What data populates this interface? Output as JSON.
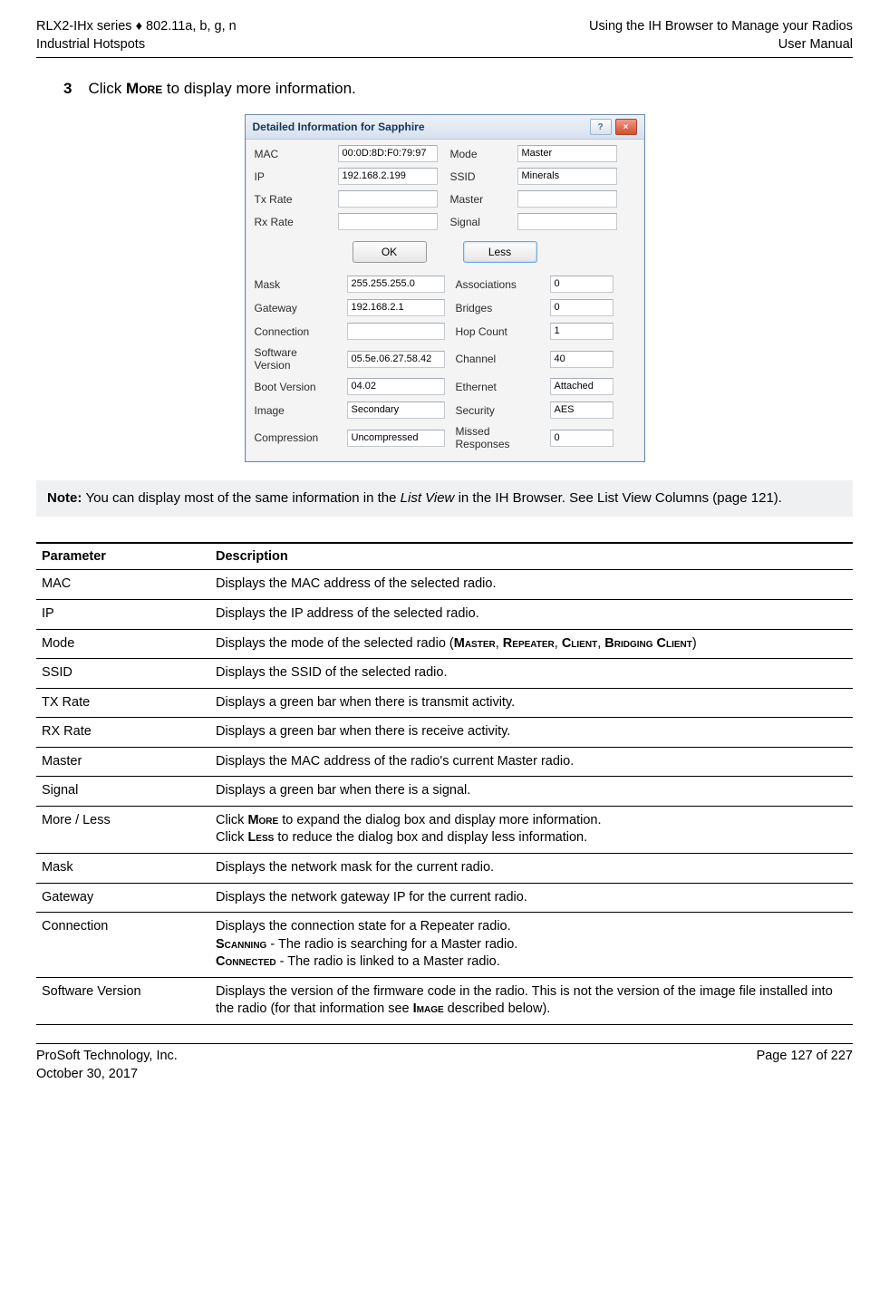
{
  "header": {
    "left1": "RLX2-IHx series ♦ 802.11a, b, g, n",
    "left2": "Industrial Hotspots",
    "right1": "Using the IH Browser to Manage your Radios",
    "right2": "User Manual"
  },
  "step": {
    "num": "3",
    "before": "Click ",
    "bold_sc": "More",
    "after": " to display more information."
  },
  "dialog": {
    "title": "Detailed Information for Sapphire",
    "help_icon": "?",
    "close_icon": "×",
    "top": {
      "mac_label": "MAC",
      "mac_value": "00:0D:8D:F0:79:97",
      "ip_label": "IP",
      "ip_value": "192.168.2.199",
      "txrate_label": "Tx Rate",
      "rxrate_label": "Rx Rate",
      "mode_label": "Mode",
      "mode_value": "Master",
      "ssid_label": "SSID",
      "ssid_value": "Minerals",
      "master_label": "Master",
      "master_value": "",
      "signal_label": "Signal"
    },
    "btn_ok": "OK",
    "btn_less": "Less",
    "bottom": {
      "mask_label": "Mask",
      "mask_value": "255.255.255.0",
      "gateway_label": "Gateway",
      "gateway_value": "192.168.2.1",
      "connection_label": "Connection",
      "connection_value": "",
      "softver_label": "Software Version",
      "softver_value": "05.5e.06.27.58.42",
      "bootver_label": "Boot Version",
      "bootver_value": "04.02",
      "image_label": "Image",
      "image_value": "Secondary",
      "compression_label": "Compression",
      "compression_value": "Uncompressed",
      "assoc_label": "Associations",
      "assoc_value": "0",
      "bridges_label": "Bridges",
      "bridges_value": "0",
      "hopcount_label": "Hop Count",
      "hopcount_value": "1",
      "channel_label": "Channel",
      "channel_value": "40",
      "ethernet_label": "Ethernet",
      "ethernet_value": "Attached",
      "security_label": "Security",
      "security_value": "AES",
      "missed_label": "Missed Responses",
      "missed_value": "0"
    }
  },
  "note": {
    "lead": "Note: ",
    "t1": "You can display most of the same information in the ",
    "italic": "List View",
    "t2": " in the IH Browser. See List View Columns (page 121)."
  },
  "table": {
    "h1": "Parameter",
    "h2": "Description",
    "rows": [
      {
        "p": "MAC",
        "html": "Displays the MAC address of the selected radio."
      },
      {
        "p": "IP",
        "html": "Displays the IP address of the selected radio."
      },
      {
        "p": "Mode",
        "html": "Displays the mode of the selected radio (<b><span class='smallcaps'>Master</span></b>, <b><span class='smallcaps'>Repeater</span></b>, <b><span class='smallcaps'>Client</span></b>, <b><span class='smallcaps'>Bridging Client</span></b>)"
      },
      {
        "p": "SSID",
        "html": "Displays the SSID of the selected radio."
      },
      {
        "p": "TX Rate",
        "html": "Displays a green bar when there is transmit activity."
      },
      {
        "p": "RX Rate",
        "html": "Displays a green bar when there is receive activity."
      },
      {
        "p": "Master",
        "html": "Displays the MAC address of the radio's current Master radio."
      },
      {
        "p": "Signal",
        "html": "Displays a green bar when there is a signal."
      },
      {
        "p": "More / Less",
        "html": "Click <b><span class='smallcaps'>More</span></b> to expand the dialog box and display more information.<br>Click <b><span class='smallcaps'>Less</span></b> to reduce the dialog box and display less information."
      },
      {
        "p": "Mask",
        "html": "Displays the network mask for the current radio."
      },
      {
        "p": "Gateway",
        "html": "Displays the network gateway IP for the current radio."
      },
      {
        "p": "Connection",
        "html": "Displays the connection state for a Repeater radio.<br><b><span class='smallcaps'>Scanning</span></b> - The radio is searching for a Master radio.<br><b><span class='smallcaps'>Connected</span></b> - The radio is linked to a Master radio."
      },
      {
        "p": "Software Version",
        "html": "Displays the version of the firmware code in the radio. This is not the version of the image file installed into the radio (for that information see <b><span class='smallcaps'>Image</span></b> described below)."
      }
    ]
  },
  "footer": {
    "left1": "ProSoft Technology, Inc.",
    "left2": "October 30, 2017",
    "right": "Page 127 of 227"
  }
}
